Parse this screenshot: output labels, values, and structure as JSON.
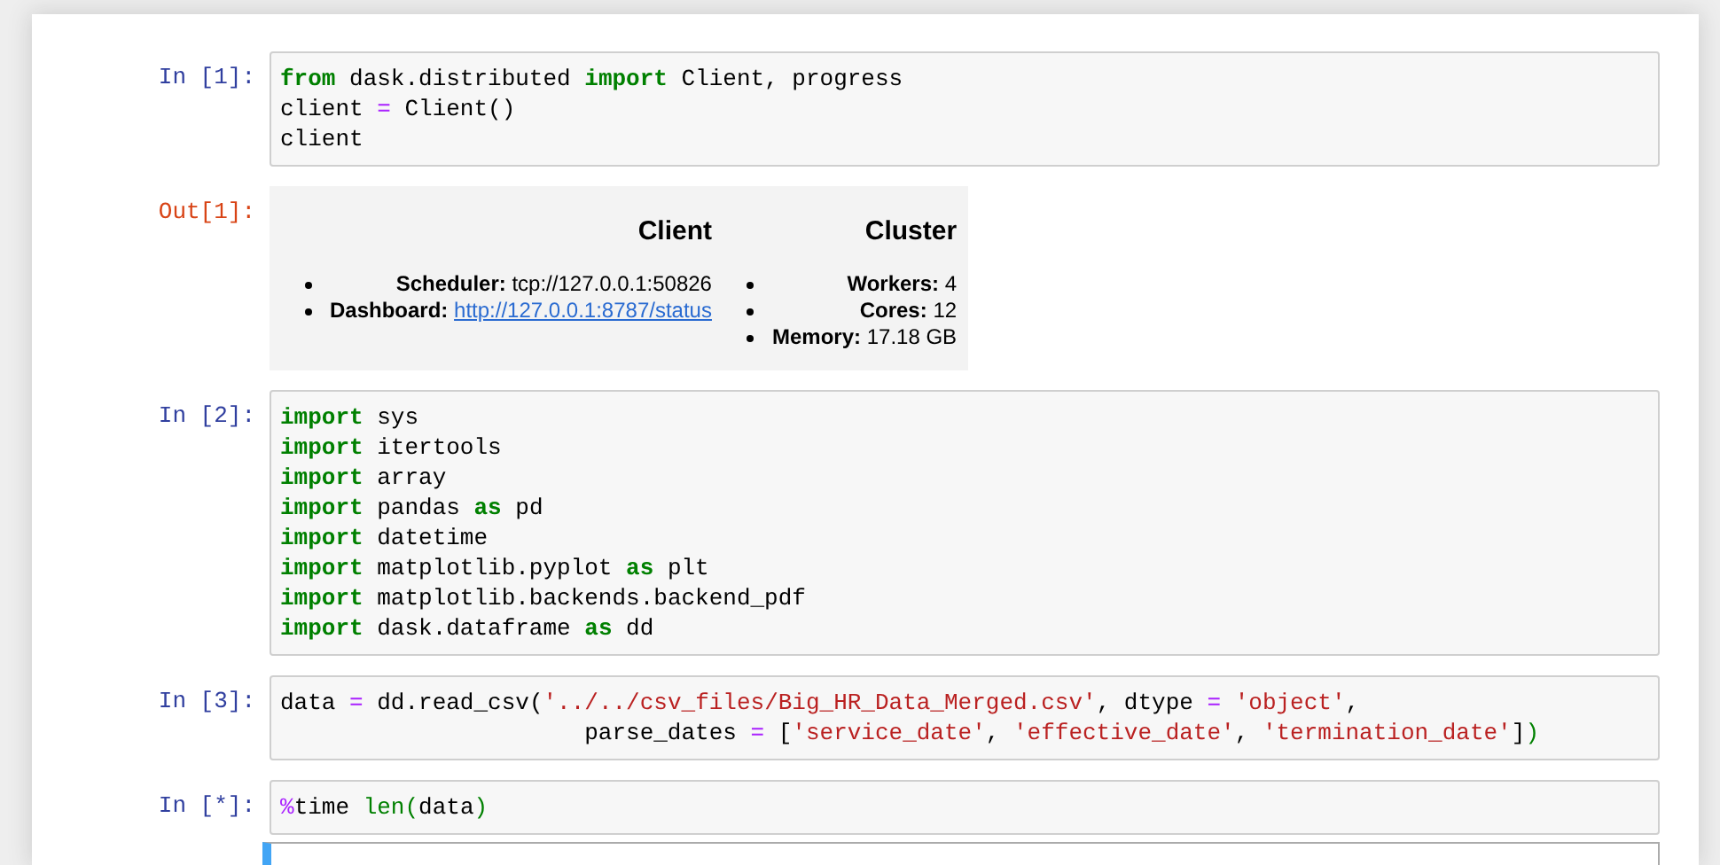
{
  "cells": [
    {
      "kind": "code",
      "prompt": "In [1]:",
      "lines": [
        [
          {
            "kind": "kw",
            "text": "from"
          },
          {
            "kind": "plain",
            "text": " dask.distributed "
          },
          {
            "kind": "kw",
            "text": "import"
          },
          {
            "kind": "plain",
            "text": " Client, progress"
          }
        ],
        [
          {
            "kind": "plain",
            "text": "client "
          },
          {
            "kind": "op",
            "text": "="
          },
          {
            "kind": "plain",
            "text": " Client()"
          }
        ],
        [
          {
            "kind": "plain",
            "text": "client"
          }
        ]
      ]
    },
    {
      "kind": "output",
      "prompt": "Out[1]:",
      "columns": [
        {
          "title": "Client",
          "rows": [
            {
              "label": "Scheduler:",
              "value": "tcp://127.0.0.1:50826",
              "kind": "text"
            },
            {
              "label": "Dashboard:",
              "value": "http://127.0.0.1:8787/status",
              "kind": "link"
            }
          ]
        },
        {
          "title": "Cluster",
          "rows": [
            {
              "label": "Workers:",
              "value": "4",
              "kind": "text"
            },
            {
              "label": "Cores:",
              "value": "12",
              "kind": "text"
            },
            {
              "label": "Memory:",
              "value": "17.18 GB",
              "kind": "text"
            }
          ]
        }
      ]
    },
    {
      "kind": "code",
      "prompt": "In [2]:",
      "lines": [
        [
          {
            "kind": "kw",
            "text": "import"
          },
          {
            "kind": "plain",
            "text": " sys"
          }
        ],
        [
          {
            "kind": "kw",
            "text": "import"
          },
          {
            "kind": "plain",
            "text": " itertools"
          }
        ],
        [
          {
            "kind": "kw",
            "text": "import"
          },
          {
            "kind": "plain",
            "text": " array"
          }
        ],
        [
          {
            "kind": "kw",
            "text": "import"
          },
          {
            "kind": "plain",
            "text": " pandas "
          },
          {
            "kind": "kw",
            "text": "as"
          },
          {
            "kind": "plain",
            "text": " pd"
          }
        ],
        [
          {
            "kind": "kw",
            "text": "import"
          },
          {
            "kind": "plain",
            "text": " datetime"
          }
        ],
        [
          {
            "kind": "kw",
            "text": "import"
          },
          {
            "kind": "plain",
            "text": " matplotlib.pyplot "
          },
          {
            "kind": "kw",
            "text": "as"
          },
          {
            "kind": "plain",
            "text": " plt"
          }
        ],
        [
          {
            "kind": "kw",
            "text": "import"
          },
          {
            "kind": "plain",
            "text": " matplotlib.backends.backend_pdf"
          }
        ],
        [
          {
            "kind": "kw",
            "text": "import"
          },
          {
            "kind": "plain",
            "text": " dask.dataframe "
          },
          {
            "kind": "kw",
            "text": "as"
          },
          {
            "kind": "plain",
            "text": " dd"
          }
        ]
      ]
    },
    {
      "kind": "code",
      "prompt": "In [3]:",
      "lines": [
        [
          {
            "kind": "plain",
            "text": "data "
          },
          {
            "kind": "op",
            "text": "="
          },
          {
            "kind": "plain",
            "text": " dd.read_csv("
          },
          {
            "kind": "str",
            "text": "'../../csv_files/Big_HR_Data_Merged.csv'"
          },
          {
            "kind": "plain",
            "text": ", dtype "
          },
          {
            "kind": "op",
            "text": "="
          },
          {
            "kind": "str",
            "text": " 'object'"
          },
          {
            "kind": "plain",
            "text": ","
          }
        ],
        [
          {
            "kind": "plain",
            "text": "                      parse_dates "
          },
          {
            "kind": "op",
            "text": "="
          },
          {
            "kind": "plain",
            "text": " ["
          },
          {
            "kind": "str",
            "text": "'service_date'"
          },
          {
            "kind": "plain",
            "text": ", "
          },
          {
            "kind": "str",
            "text": "'effective_date'"
          },
          {
            "kind": "plain",
            "text": ", "
          },
          {
            "kind": "str",
            "text": "'termination_date'"
          },
          {
            "kind": "plain",
            "text": "]"
          },
          {
            "kind": "match",
            "text": ")"
          }
        ]
      ]
    },
    {
      "kind": "code",
      "prompt": "In [*]:",
      "lines": [
        [
          {
            "kind": "op",
            "text": "%"
          },
          {
            "kind": "plain",
            "text": "time "
          },
          {
            "kind": "builtin",
            "text": "len"
          },
          {
            "kind": "match",
            "text": "("
          },
          {
            "kind": "plain",
            "text": "data"
          },
          {
            "kind": "match",
            "text": ")"
          }
        ]
      ]
    },
    {
      "kind": "empty",
      "selected": true
    }
  ]
}
